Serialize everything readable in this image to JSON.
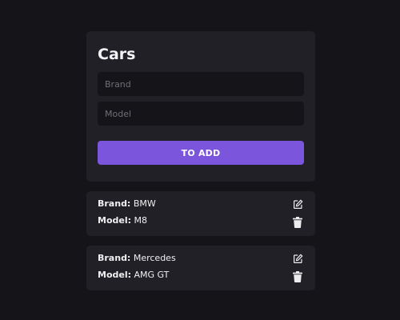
{
  "form": {
    "title": "Cars",
    "brand_placeholder": "Brand",
    "model_placeholder": "Model",
    "brand_value": "",
    "model_value": "",
    "add_label": "TO ADD"
  },
  "cars": [
    {
      "brand_label": "Brand:",
      "brand": "BMW",
      "model_label": "Model:",
      "model": "M8",
      "edit_icon": "edit-icon",
      "delete_icon": "trash-icon"
    },
    {
      "brand_label": "Brand:",
      "brand": "Mercedes",
      "model_label": "Model:",
      "model": "AMG GT",
      "edit_icon": "edit-icon",
      "delete_icon": "trash-icon"
    }
  ],
  "colors": {
    "background": "#141419",
    "card": "#202026",
    "accent": "#7b55dc"
  }
}
